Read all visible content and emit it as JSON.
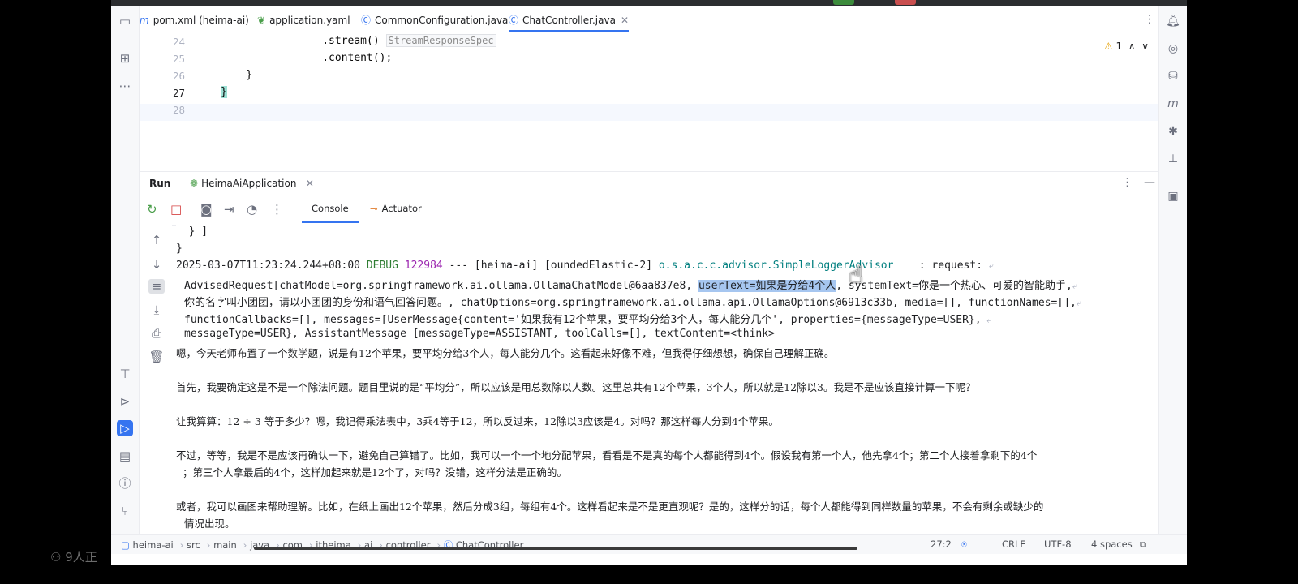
{
  "tabs": [
    {
      "label": "pom.xml (heima-ai)",
      "icon": "maven-icon"
    },
    {
      "label": "application.yaml",
      "icon": "yaml-icon"
    },
    {
      "label": "CommonConfiguration.java",
      "icon": "class-icon"
    },
    {
      "label": "ChatController.java",
      "icon": "class-icon",
      "active": true
    }
  ],
  "editor": {
    "lines": [
      {
        "num": "24",
        "text": "                .stream()",
        "hint": "StreamResponseSpec"
      },
      {
        "num": "25",
        "text": "                .content();"
      },
      {
        "num": "26",
        "text": "    }"
      },
      {
        "num": "27",
        "text": "}"
      },
      {
        "num": "28",
        "text": ""
      }
    ],
    "warnings": "1"
  },
  "run": {
    "title": "Run",
    "config": "HeimaAiApplication",
    "tabs": [
      "Console",
      "Actuator"
    ]
  },
  "console": {
    "l1": "  } ]",
    "l2": "}",
    "l3_time": "2025-03-07T11:23:24.244+08:00",
    "l3_level": "DEBUG",
    "l3_pid": "122984",
    "l3_mid": " --- [heima-ai] [oundedElastic-2] ",
    "l3_logger": "o.s.a.c.c.advisor.SimpleLoggerAdvisor",
    "l3_tail": "    : request: ",
    "l4_a": "AdvisedRequest[chatModel=org.springframework.ai.ollama.OllamaChatModel@6aa837e8, ",
    "l4_sel": "userText=如果是分给4个人",
    "l4_b": ", systemText=你是一个热心、可爱的智能助手,",
    "l5": "你的名字叫小团团，请以小团团的身份和语气回答问题。, chatOptions=org.springframework.ai.ollama.api.OllamaOptions@6913c33b, media=[], functionNames=[],",
    "l6": "functionCallbacks=[], messages=[UserMessage{content='如果我有12个苹果，要平均分给3个人，每人能分几个', properties={messageType=USER},",
    "l7": "messageType=USER}, AssistantMessage [messageType=ASSISTANT, toolCalls=[], textContent=<think>",
    "l8": "嗯，今天老师布置了一个数学题，说是有12个苹果，要平均分给3个人，每人能分几个。这看起来好像不难，但我得仔细想想，确保自己理解正确。",
    "l9": "首先，我要确定这是不是一个除法问题。题目里说的是“平均分”，所以应该是用总数除以人数。这里总共有12个苹果，3个人，所以就是12除以3。我是不是应该直接计算一下呢？",
    "l10": "让我算算：12 ÷ 3 等于多少？嗯，我记得乘法表中，3乘4等于12，所以反过来，12除以3应该是4。对吗？那这样每人分到4个苹果。",
    "l11": "不过，等等，我是不是应该再确认一下，避免自己算错了。比如，我可以一个一个地分配苹果，看看是不是真的每个人都能得到4个。假设我有第一个人，他先拿4个；第二个人接着拿剩下的4个",
    "l12": "；第三个人拿最后的4个，这样加起来就是12个了，对吗？没错，这样分法是正确的。",
    "l13": "或者，我可以画图来帮助理解。比如，在纸上画出12个苹果，然后分成3组，每组有4个。这样看起来是不是更直观呢？是的，这样分的话，每个人都能得到同样数量的苹果，不会有剩余或缺少的",
    "l14": "情况出现。"
  },
  "breadcrumb": [
    "heima-ai",
    "src",
    "main",
    "java",
    "com",
    "itheima",
    "ai",
    "controller",
    "ChatController"
  ],
  "status": {
    "position": "27:2",
    "line_sep": "CRLF",
    "encoding": "UTF-8",
    "indent": "4 spaces"
  },
  "outside_text": "9人正"
}
